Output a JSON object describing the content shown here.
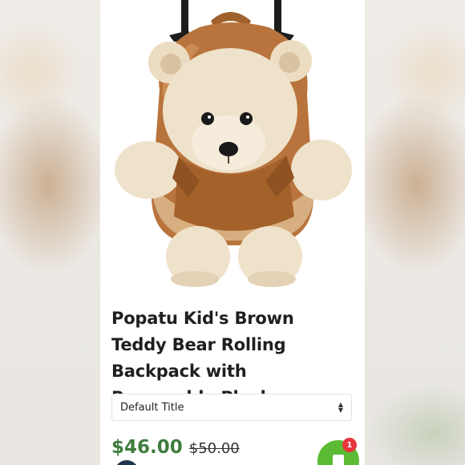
{
  "product": {
    "image_alt": "Brown teddy bear rolling backpack",
    "title": "Popatu Kid's Brown Teddy Bear Rolling Backpack with Removable Plush",
    "variant": {
      "selected": "Default Title",
      "icon": "chevron-up-down-icon"
    },
    "price": {
      "current": "$46.00",
      "original": "$50.00"
    }
  },
  "cart": {
    "icon": "shopping-bag-icon",
    "badge_count": "1"
  },
  "colors": {
    "price_accent": "#3f7d3d",
    "cart_button": "#5bbb34",
    "badge": "#e8343d"
  }
}
